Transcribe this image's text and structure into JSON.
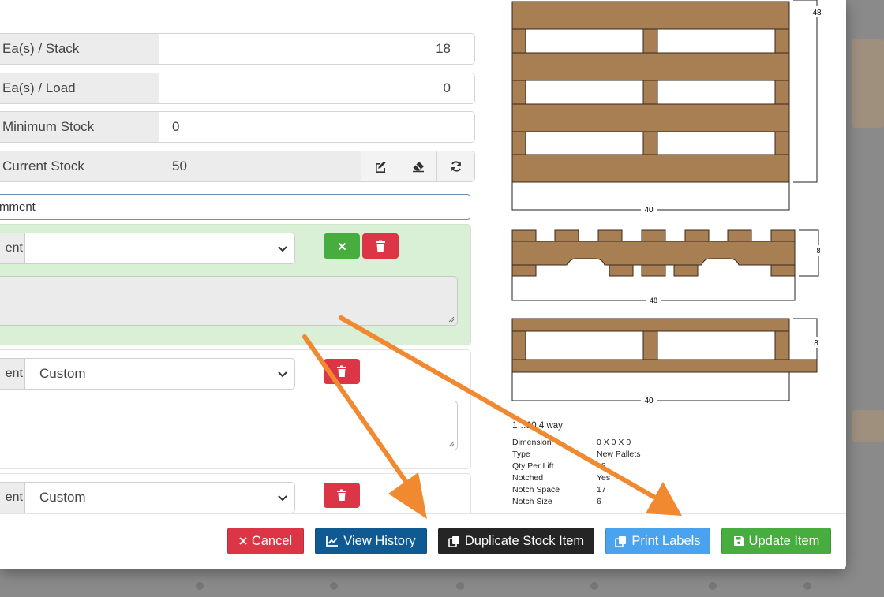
{
  "colors": {
    "accent_arrow": "#f0892f",
    "danger": "#dc3545",
    "primary_dark": "#0f5a93",
    "dark": "#252525",
    "info": "#4aa3ef",
    "success": "#47ad3e",
    "wood": "#a87f52"
  },
  "form": {
    "stack_label": "Ea(s) / Stack",
    "stack_value": "18",
    "load_label": "Ea(s) / Load",
    "load_value": "0",
    "min_label": "Minimum Stock",
    "min_value": "0",
    "current_label": "Current Stock",
    "current_value": "50",
    "current_icons": [
      "edit-icon",
      "eraser-icon",
      "refresh-icon"
    ]
  },
  "comments": {
    "input_text": "mment",
    "new_entry": {
      "label": "ent",
      "select_value": ""
    },
    "entries": [
      {
        "label": "ent",
        "select_value": "Custom"
      },
      {
        "label": "ent",
        "select_value": "Custom"
      }
    ]
  },
  "diagram": {
    "dim_top_height": "48",
    "dim_top_width": "40",
    "dim_side_width": "48",
    "dim_side_height": "8",
    "dim_end_width": "40",
    "dim_end_height": "8",
    "title": "1…10 4 way",
    "specs": [
      {
        "label": "Dimension",
        "value": "0 X 0 X 0"
      },
      {
        "label": "Type",
        "value": "New Pallets"
      },
      {
        "label": "Qty Per Lift",
        "value": "18"
      },
      {
        "label": "Notched",
        "value": "Yes"
      },
      {
        "label": "Notch Space",
        "value": "17"
      },
      {
        "label": "Notch Size",
        "value": "6"
      }
    ]
  },
  "footer": {
    "cancel": "Cancel",
    "history": "View History",
    "duplicate": "Duplicate Stock Item",
    "print": "Print Labels",
    "update": "Update Item"
  }
}
